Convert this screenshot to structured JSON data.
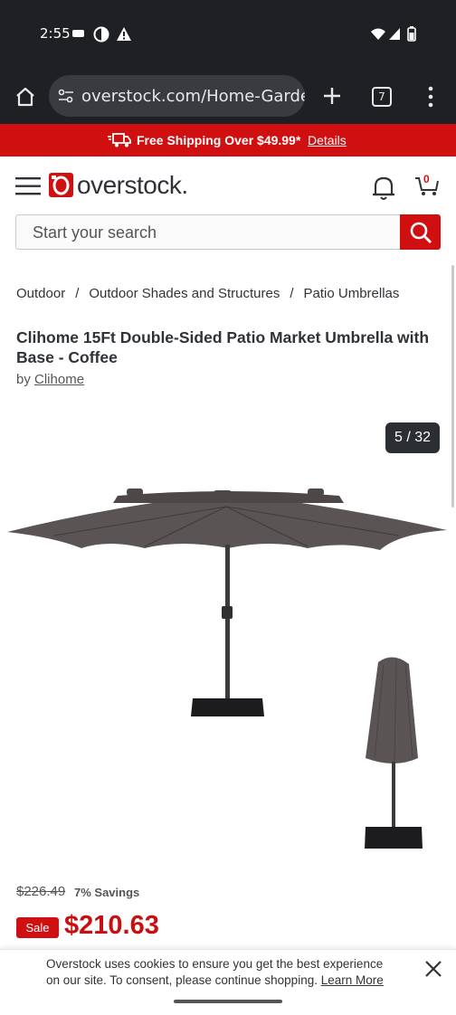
{
  "status_bar": {
    "time": "2:55",
    "icons": [
      "notification-icon",
      "vpn-icon",
      "alert-icon",
      "wifi-icon",
      "signal-icon",
      "battery-icon"
    ]
  },
  "browser": {
    "url": "overstock.com/Home-Garden",
    "tab_count": "7",
    "icons": [
      "home-icon",
      "site-settings-icon",
      "new-tab-icon",
      "tab-switcher-icon",
      "more-menu-icon"
    ]
  },
  "promo": {
    "text": "Free Shipping Over $49.99*",
    "link": "Details"
  },
  "header": {
    "logo_text": "overstock.",
    "cart_count": "0"
  },
  "search": {
    "placeholder": "Start your search"
  },
  "breadcrumb": [
    "Outdoor",
    "Outdoor Shades and Structures",
    "Patio Umbrellas"
  ],
  "product": {
    "title": "Clihome 15Ft Double-Sided Patio Market Umbrella with Base - Coffee",
    "by_label": "by",
    "brand": "Clihome",
    "image_counter": "5 / 32",
    "was_price": "$226.49",
    "savings": "7% Savings",
    "sale_label": "Sale",
    "price": "$210.63"
  },
  "cookie": {
    "text": "Overstock uses cookies to ensure you get the best experience on our site. To consent, please continue shopping.",
    "link": "Learn More"
  },
  "colors": {
    "brand_red": "#d00f10",
    "price_red": "#c80e0e",
    "dark_bar": "#1f2024",
    "umbrella": "#5b5455"
  }
}
